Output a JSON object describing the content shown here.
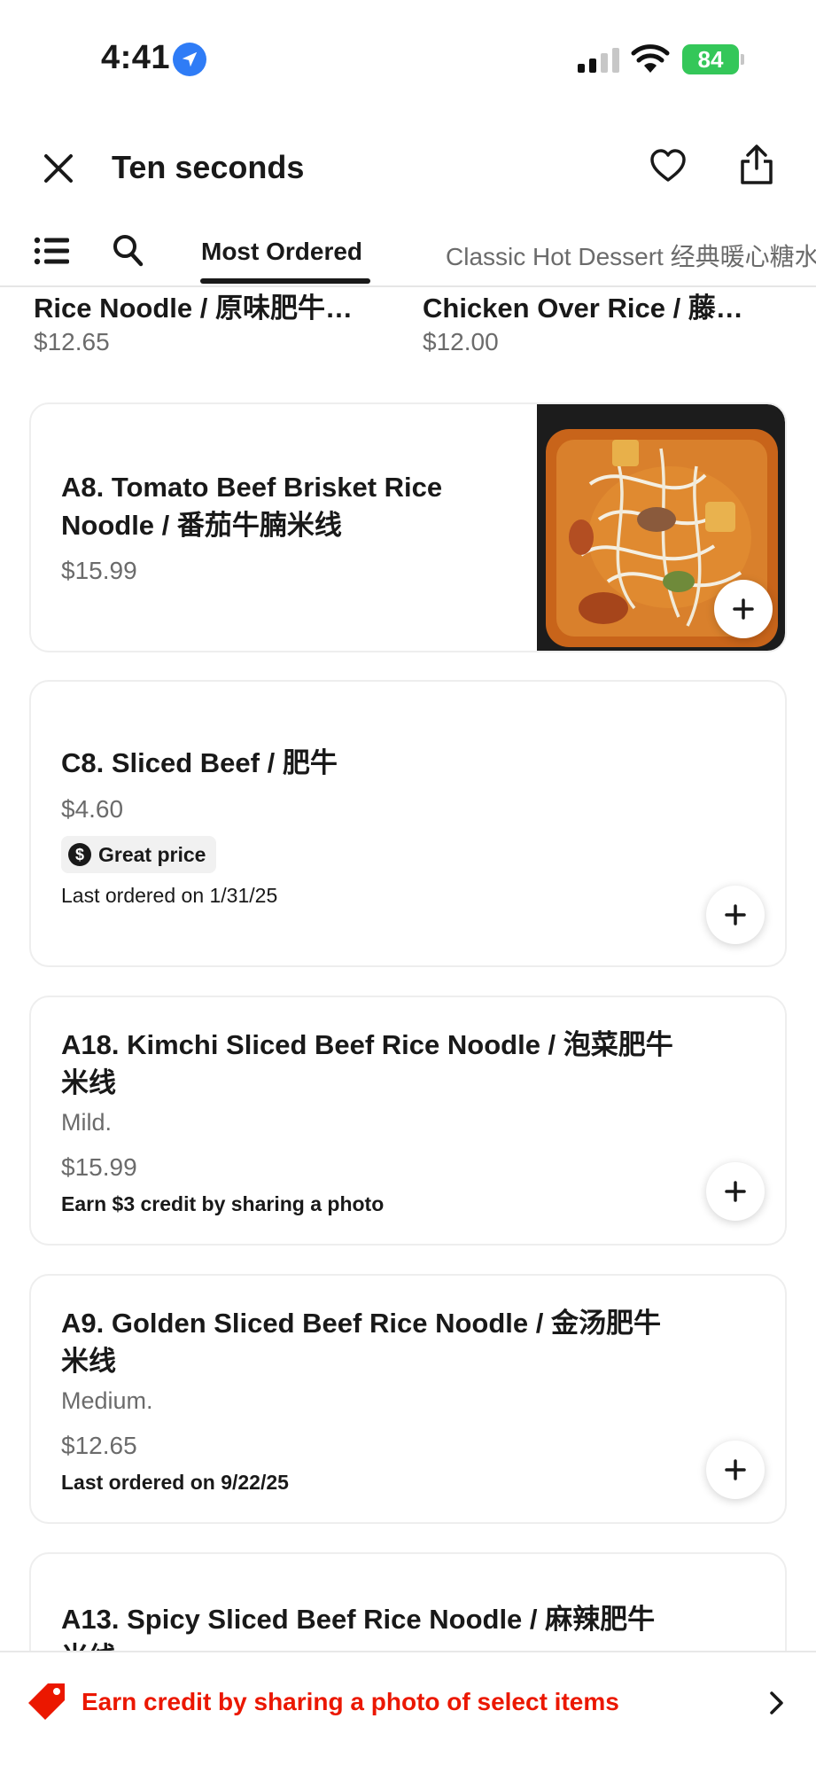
{
  "status_bar": {
    "time": "4:41",
    "battery": "84"
  },
  "header": {
    "title": "Ten seconds"
  },
  "tabs": [
    {
      "label": "Most Ordered",
      "active": true
    },
    {
      "label": "Classic Hot Dessert 经典暖心糖水",
      "active": false
    }
  ],
  "partial_items": [
    {
      "name": "Rice Noodle / 原味肥牛…",
      "price": "$12.65"
    },
    {
      "name": "Chicken Over Rice / 藤…",
      "price": "$12.00"
    }
  ],
  "items": [
    {
      "name_line1": "A8. Tomato Beef Brisket Rice",
      "name_line2": "Noodle / 番茄牛腩米线",
      "price": "$15.99"
    },
    {
      "name": "C8. Sliced Beef / 肥牛",
      "price": "$4.60",
      "badge": "Great price",
      "note": "Last ordered on 1/31/25"
    },
    {
      "name_line1": "A18. Kimchi Sliced Beef Rice Noodle / 泡菜肥牛",
      "name_line2": "米线",
      "desc": "Mild.",
      "price": "$15.99",
      "note": "Earn $3 credit by sharing a photo"
    },
    {
      "name_line1": "A9. Golden Sliced Beef Rice Noodle / 金汤肥牛",
      "name_line2": "米线",
      "desc": "Medium.",
      "price": "$12.65",
      "note": "Last ordered on 9/22/25"
    },
    {
      "name_line1": "A13. Spicy Sliced Beef Rice Noodle / 麻辣肥牛",
      "name_line2": "米线"
    }
  ],
  "banner": {
    "text": "Earn credit by sharing a photo of select items"
  },
  "colors": {
    "accent": "#eb1700",
    "battery": "#34c759",
    "location": "#2f7cf6"
  },
  "icons": [
    "location-arrow-icon",
    "signal-icon",
    "wifi-icon",
    "battery-icon",
    "close-icon",
    "heart-icon",
    "share-icon",
    "list-icon",
    "search-icon",
    "plus-icon",
    "dollar-icon",
    "tag-icon",
    "chevron-right-icon"
  ]
}
